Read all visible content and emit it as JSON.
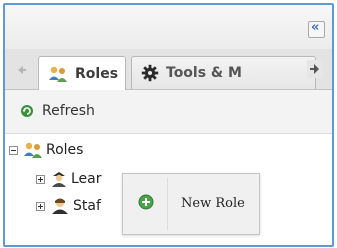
{
  "panel": {
    "collapse_label": "«"
  },
  "tabs": [
    {
      "label": "Roles",
      "active": true
    },
    {
      "label": "Tools & M",
      "active": false
    }
  ],
  "toolbar": {
    "refresh_label": "Refresh"
  },
  "tree": {
    "root": {
      "label": "Roles",
      "expanded": true
    },
    "children": [
      {
        "label": "Lear",
        "expanded": false
      },
      {
        "label": "Staf",
        "expanded": false
      }
    ]
  },
  "context_menu": {
    "items": [
      {
        "label": "New Role",
        "icon": "add-icon"
      }
    ]
  },
  "colors": {
    "border_accent": "#5d9ad6",
    "add_icon": "#4aa34a",
    "refresh_icon": "#3c8f3c"
  }
}
